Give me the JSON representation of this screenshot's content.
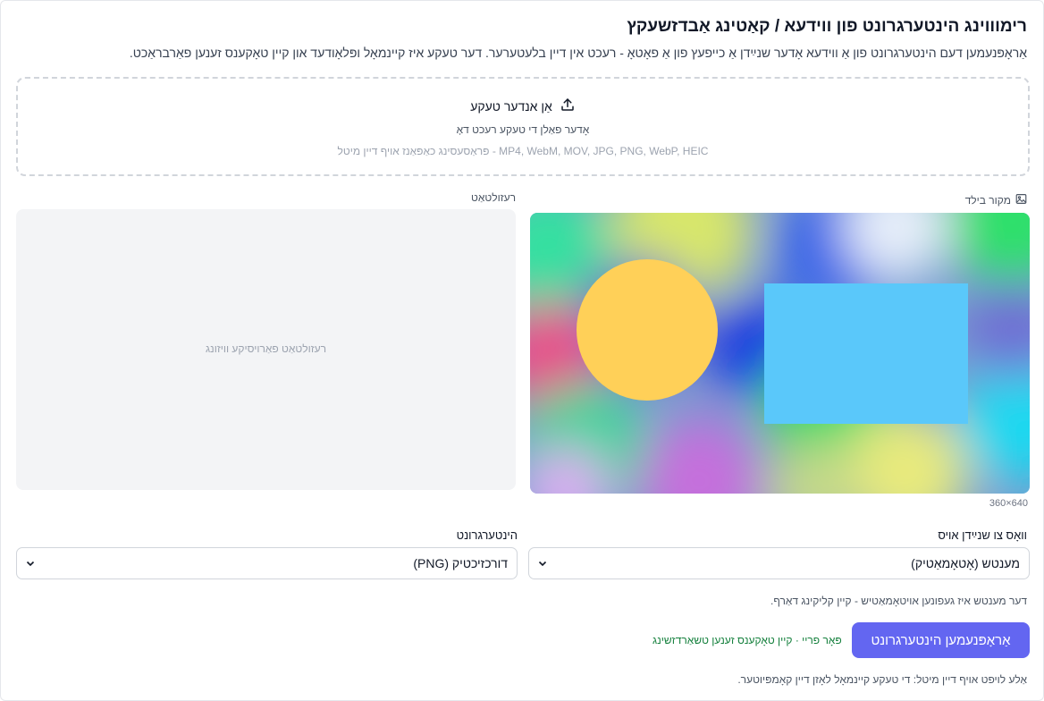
{
  "header": {
    "title": "רימוווינג הינטערגרונט פון ווידעא / קאַטינג אַבדזשעקץ",
    "subtitle": "אַראָפּנעמען דעם הינטערגרונט פון אַ ווידעא אָדער שנײַדן אַ כייפעץ פון אַ פאָטאָ - רעכט אין דיין בלעטערער. דער טעקע איז קיינמאָל ופּלאָודעד און קיין טאָקענס זענען פאַרבראַכט."
  },
  "dropzone": {
    "title": "אַן אנדער טעקע",
    "icon": "upload-icon",
    "hint": "אָדער פאַלן די טעקע רעכט דאָ",
    "formats": "MP4, WebM, MOV, JPG, PNG, WebP, HEIC - פּראַסעסינג כאַפּאַנז אויף דיין מיטל"
  },
  "source": {
    "label": "מקור בילד",
    "icon": "image-icon",
    "dimensions": "360×640"
  },
  "result": {
    "label": "רעזולטאַט",
    "placeholder": "רעזולטאַט פאַרויסיקע וויזונג"
  },
  "controls": {
    "what_label": "וואָס צו שנײַדן אויס",
    "what_value": "מענטש (אָטאָמאַטיק)",
    "bg_label": "הינטערגרונט",
    "bg_value": "דורכזיכטיק (PNG)",
    "hint": "דער מענטש איז געפונען אויטאָמאַטיש - קיין קליקינג דאַרף."
  },
  "actions": {
    "primary_label": "אַראָפּנעמען הינטערגרונט",
    "free_note": "פּאָר פריי · קיין טאָקענס זענען טשאַרדזשינג"
  },
  "footer": {
    "note": "אַלע לויפט אויף דיין מיטל: די טעקע קיינמאָל לאָזן דיין קאָמפּיוטער."
  },
  "colors": {
    "accent": "#6366f1",
    "free_note": "#15803d",
    "circle": "#ffd058",
    "rectangle": "#5ac8fa"
  }
}
